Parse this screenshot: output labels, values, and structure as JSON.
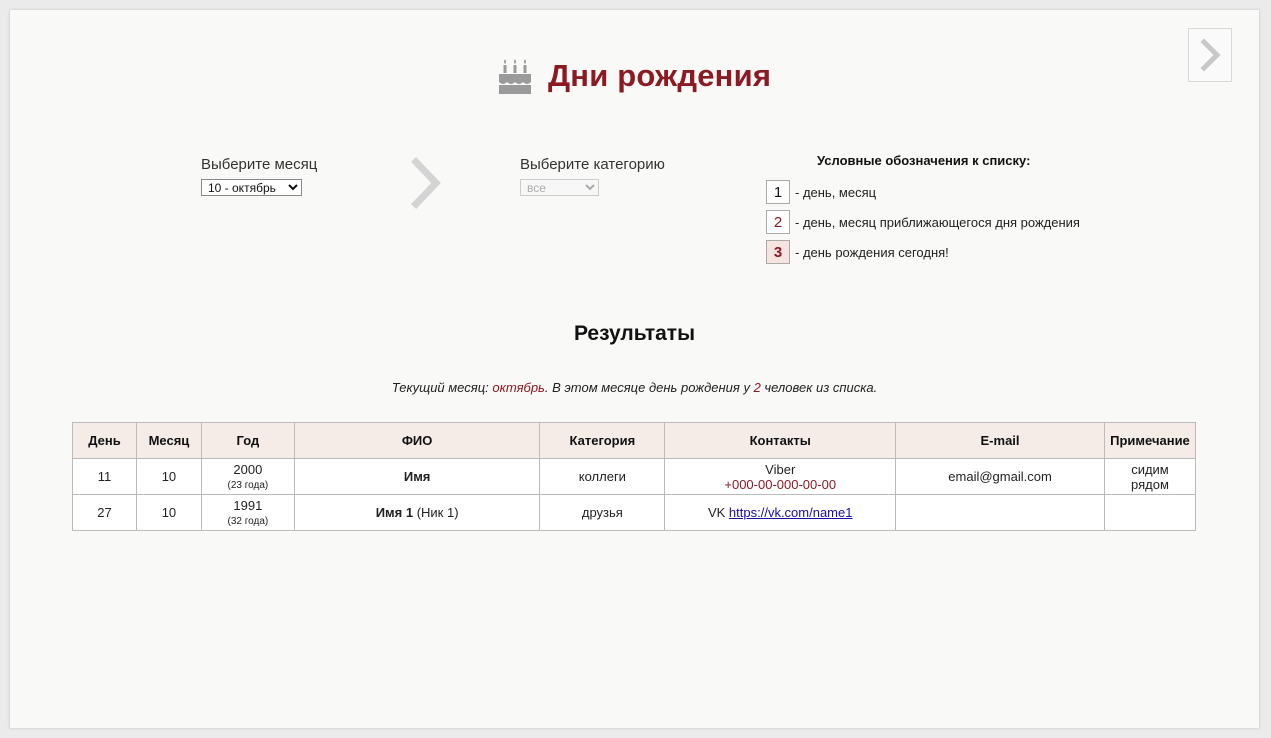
{
  "header": {
    "title": "Дни рождения"
  },
  "filters": {
    "month_label": "Выберите месяц",
    "month_value": "10 - октябрь",
    "category_label": "Выберите категорию",
    "category_value": "все"
  },
  "legend": {
    "title": "Условные обозначения к списку:",
    "items": [
      {
        "num": "1",
        "text": "- день, месяц"
      },
      {
        "num": "2",
        "text": "- день, месяц приближающегося дня рождения"
      },
      {
        "num": "3",
        "text": "- день рождения сегодня!"
      }
    ]
  },
  "results": {
    "title": "Результаты",
    "info_prefix": "Текущий месяц: ",
    "info_month": "октябрь",
    "info_middle": ". В этом месяце день рождения у ",
    "info_count": "2",
    "info_suffix": " человек из списка.",
    "columns": [
      "День",
      "Месяц",
      "Год",
      "ФИО",
      "Категория",
      "Контакты",
      "E-mail",
      "Примечание"
    ],
    "rows": [
      {
        "day": "11",
        "month": "10",
        "year": "2000",
        "age": "(23 года)",
        "name": "Имя",
        "nick": "",
        "category": "коллеги",
        "contact_type": "Viber",
        "contact_value": "+000-00-000-00-00",
        "email": "email@gmail.com",
        "note": "сидим рядом"
      },
      {
        "day": "27",
        "month": "10",
        "year": "1991",
        "age": "(32 года)",
        "name": "Имя 1",
        "nick": "(Ник 1)",
        "category": "друзья",
        "contact_type": "VK",
        "contact_value": "https://vk.com/name1",
        "email": "",
        "note": ""
      }
    ]
  }
}
